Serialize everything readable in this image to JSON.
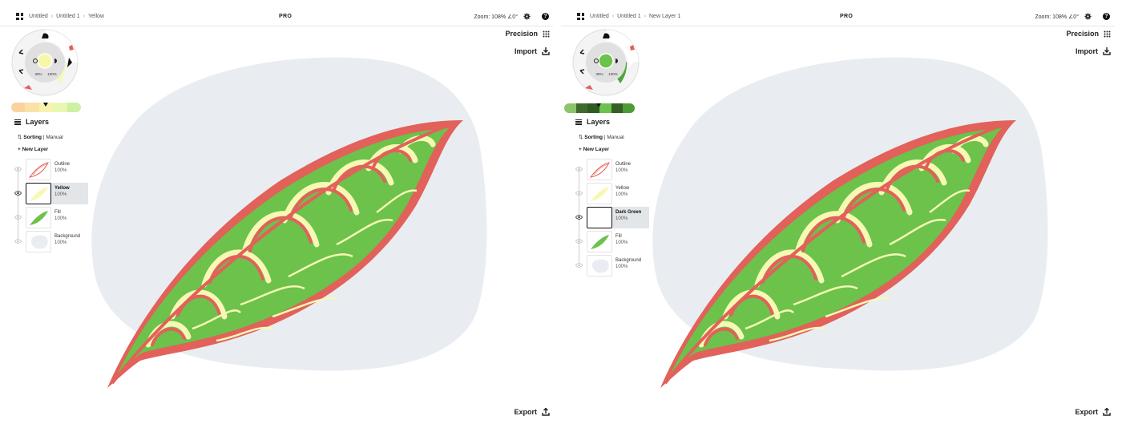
{
  "colors": {
    "outline_red": "#e2615a",
    "fill_green": "#6cc24a",
    "pale_yellow": "#f5f9b4",
    "blob_gray": "#e9edf1",
    "dark_green": "#2f5b22"
  },
  "left": {
    "breadcrumb": [
      "Untitled",
      "Untitled 1",
      "Yellow"
    ],
    "badge": "PRO",
    "zoom": "Zoom: 108% ∠0°",
    "precision": "Precision",
    "import": "Import",
    "export": "Export",
    "wheel": {
      "opacity": "30%",
      "size": "100%",
      "current_color": "#f7f7a8"
    },
    "swatches": [
      "#fbd29c",
      "#fbe0a9",
      "#f8f3ae",
      "#e8f7b1",
      "#cdf0a2"
    ],
    "layers_title": "Layers",
    "sorting_label": "Sorting",
    "sorting_mode": "Manual",
    "new_layer": "New Layer",
    "layers": [
      {
        "name": "Outline",
        "opacity": "100%",
        "selected": false,
        "thumb": "outline"
      },
      {
        "name": "Yellow",
        "opacity": "100%",
        "selected": true,
        "thumb": "yellow"
      },
      {
        "name": "Fill",
        "opacity": "100%",
        "selected": false,
        "thumb": "fill"
      },
      {
        "name": "Background",
        "opacity": "100%",
        "selected": false,
        "thumb": "background"
      }
    ]
  },
  "right": {
    "breadcrumb": [
      "Untitled",
      "Untitled 1",
      "New Layer 1"
    ],
    "badge": "PRO",
    "zoom": "Zoom: 108% ∠0°",
    "precision": "Precision",
    "import": "Import",
    "export": "Export",
    "wheel": {
      "opacity": "30%",
      "size": "100%",
      "current_color": "#6cc24a"
    },
    "swatches": [
      "#8cc46b",
      "#3e6b2c",
      "#2f5b22",
      "#6cc24a",
      "#355f27",
      "#4e9a34"
    ],
    "layers_title": "Layers",
    "sorting_label": "Sorting",
    "sorting_mode": "Manual",
    "new_layer": "New Layer",
    "layers": [
      {
        "name": "Outline",
        "opacity": "100%",
        "selected": false,
        "thumb": "outline"
      },
      {
        "name": "Yellow",
        "opacity": "100%",
        "selected": false,
        "thumb": "yellow"
      },
      {
        "name": "Dark Green",
        "opacity": "100%",
        "selected": true,
        "thumb": "empty"
      },
      {
        "name": "Fill",
        "opacity": "100%",
        "selected": false,
        "thumb": "fill"
      },
      {
        "name": "Background",
        "opacity": "100%",
        "selected": false,
        "thumb": "background"
      }
    ]
  }
}
